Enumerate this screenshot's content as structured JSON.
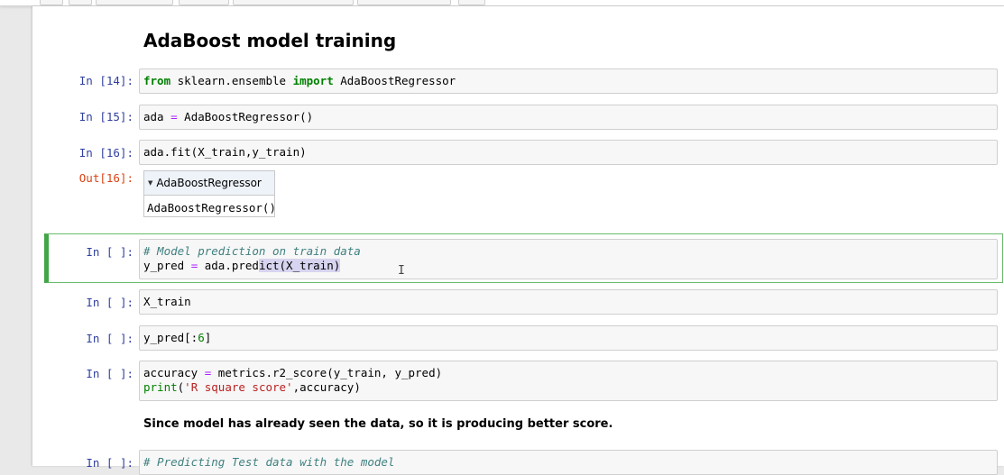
{
  "heading": "AdaBoost model training",
  "cells": [
    {
      "prompt": "In [14]:",
      "lines": [
        [
          {
            "t": "from",
            "c": "kw"
          },
          {
            "t": " sklearn.ensemble "
          },
          {
            "t": "import",
            "c": "kw"
          },
          {
            "t": " AdaBoostRegressor"
          }
        ]
      ]
    },
    {
      "prompt": "In [15]:",
      "lines": [
        [
          {
            "t": "ada "
          },
          {
            "t": "=",
            "c": "op"
          },
          {
            "t": " AdaBoostRegressor()"
          }
        ]
      ]
    },
    {
      "prompt": "In [16]:",
      "lines": [
        [
          {
            "t": "ada.fit(X_train,y_train)"
          }
        ]
      ]
    },
    {
      "prompt": "In [ ]:",
      "lines": [
        [
          {
            "t": "# Model prediction on train data",
            "c": "cmt"
          }
        ],
        [
          {
            "t": "y_pred "
          },
          {
            "t": "=",
            "c": "op"
          },
          {
            "t": " ada.pred"
          },
          {
            "t": "ict(X_train)",
            "c": "sel"
          }
        ]
      ]
    },
    {
      "prompt": "In [ ]:",
      "lines": [
        [
          {
            "t": "X_train"
          }
        ]
      ]
    },
    {
      "prompt": "In [ ]:",
      "lines": [
        [
          {
            "t": "y_pred[:"
          },
          {
            "t": "6",
            "c": "num"
          },
          {
            "t": "]"
          }
        ]
      ]
    },
    {
      "prompt": "In [ ]:",
      "lines": [
        [
          {
            "t": "accuracy "
          },
          {
            "t": "=",
            "c": "op"
          },
          {
            "t": " metrics.r2_score(y_train, y_pred)"
          }
        ],
        [
          {
            "t": "print",
            "c": "kw2"
          },
          {
            "t": "("
          },
          {
            "t": "'R square score'",
            "c": "str"
          },
          {
            "t": ",accuracy)"
          }
        ]
      ]
    },
    {
      "prompt": "In [ ]:",
      "lines": [
        [
          {
            "t": "# Predicting Test data with the model",
            "c": "cmt"
          }
        ]
      ]
    }
  ],
  "output": {
    "prompt": "Out[16]:",
    "widget_title": "AdaBoostRegressor",
    "widget_body": "AdaBoostRegressor()"
  },
  "markdown_note": "Since model has already seen the data, so it is producing better score.",
  "colors": {
    "input_prompt": "#303f9f",
    "output_prompt": "#d84315",
    "active_border": "#42a548"
  }
}
